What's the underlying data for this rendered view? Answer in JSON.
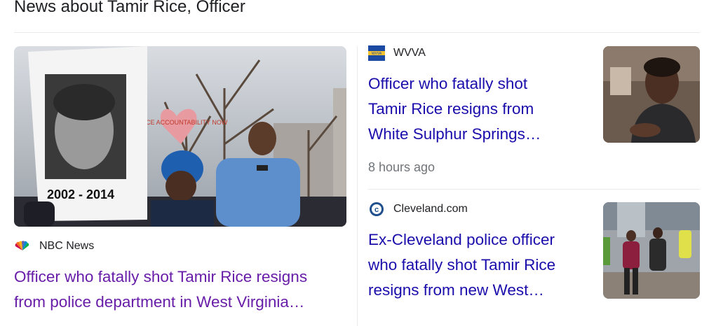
{
  "section": {
    "heading": "News about Tamir Rice, Officer"
  },
  "cards": [
    {
      "source": "NBC News",
      "source_icon": "nbc-peacock-icon",
      "title_lines": [
        "Officer who fatally shot Tamir Rice resigns",
        "from police department in West Virginia…"
      ],
      "title_color": "#681da8",
      "image_caption": "2002 - 2014",
      "sign_text": "POLICE ACCOUNTABILITY NOW"
    },
    {
      "source": "WVVA",
      "source_icon": "wvva-logo-icon",
      "title_lines": [
        "Officer who fatally shot",
        "Tamir Rice resigns from",
        "White Sulphur Springs…"
      ],
      "title_color": "#1a0dab",
      "time": "8 hours ago"
    },
    {
      "source": "Cleveland.com",
      "source_icon": "cleveland-com-logo-icon",
      "title_lines": [
        "Ex-Cleveland police officer",
        "who fatally shot Tamir Rice",
        "resigns from new West…"
      ],
      "title_color": "#1a0dab"
    }
  ]
}
